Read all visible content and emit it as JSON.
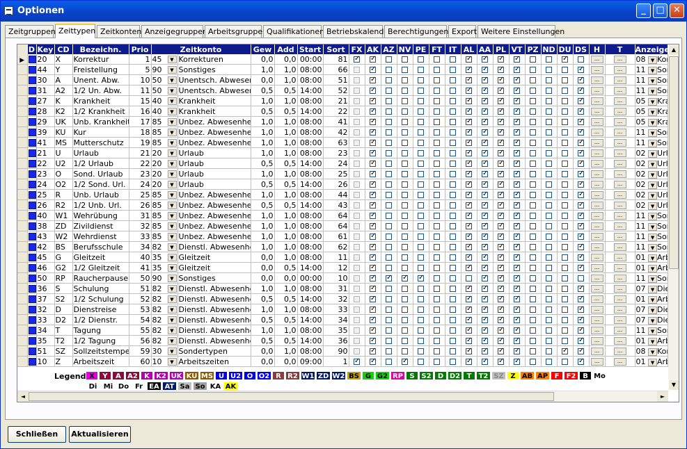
{
  "window": {
    "title": "Optionen"
  },
  "tabs": [
    "Zeitgruppen",
    "Zeittypen",
    "Zeitkonten",
    "Anzeigegruppen",
    "Arbeitsgruppen",
    "Qualifikationen",
    "Betriebskalender",
    "Berechtigungen",
    "Export",
    "Weitere Einstellungen"
  ],
  "active_tab": "Zeittypen",
  "columns": [
    "D",
    "Key",
    "CD",
    "Bezeichn.",
    "Prio",
    "Zeitkonto",
    "Gew",
    "Add",
    "Start",
    "Sort",
    "FX",
    "AK",
    "AZ",
    "NV",
    "PE",
    "FT",
    "IT",
    "AL",
    "AA",
    "PL",
    "VT",
    "PZ",
    "ND",
    "DU",
    "DS",
    "H",
    "T",
    "Anzeige"
  ],
  "rows": [
    {
      "key": "20",
      "cd": "X",
      "name": "Korrektur",
      "prio": "1",
      "zk": "45",
      "konto": "Korrekturen",
      "gew": "0,0",
      "add": "0,0",
      "start": "00:00",
      "sort": "81",
      "flags": "x1000001110110",
      "az_lbl": "08",
      "anz": "Korre"
    },
    {
      "key": "44",
      "cd": "Y",
      "name": "Freistellung",
      "prio": "5",
      "zk": "90",
      "konto": "Sonstiges",
      "gew": "1,0",
      "add": "1,0",
      "start": "08:00",
      "sort": "66",
      "flags": "01000001110001",
      "az_lbl": "11",
      "anz": "Sonst"
    },
    {
      "key": "30",
      "cd": "A",
      "name": "Unent. Abw.",
      "prio": "10",
      "zk": "50",
      "konto": "Unentsch. Abwesenheit",
      "gew": "0,0",
      "add": "1,0",
      "start": "08:00",
      "sort": "51",
      "flags": "01000001110001",
      "az_lbl": "11",
      "anz": "Sonst"
    },
    {
      "key": "31",
      "cd": "A2",
      "name": "1/2 Un. Abw.",
      "prio": "11",
      "zk": "50",
      "konto": "Unentsch. Abwesenheit",
      "gew": "0,5",
      "add": "0,5",
      "start": "14:00",
      "sort": "52",
      "flags": "01000001110001",
      "az_lbl": "11",
      "anz": "Sonst"
    },
    {
      "key": "27",
      "cd": "K",
      "name": "Krankheit",
      "prio": "15",
      "zk": "40",
      "konto": "Krankheit",
      "gew": "1,0",
      "add": "1,0",
      "start": "08:00",
      "sort": "21",
      "flags": "01000001110001",
      "az_lbl": "05",
      "anz": "Krank"
    },
    {
      "key": "28",
      "cd": "K2",
      "name": "1/2 Krankheit",
      "prio": "16",
      "zk": "40",
      "konto": "Krankheit",
      "gew": "0,5",
      "add": "0,5",
      "start": "14:00",
      "sort": "22",
      "flags": "01000001110001",
      "az_lbl": "05",
      "anz": "Krank"
    },
    {
      "key": "29",
      "cd": "UK",
      "name": "Unb. Krankheit",
      "prio": "17",
      "zk": "85",
      "konto": "Unbez. Abwesenheit",
      "gew": "1,0",
      "add": "1,0",
      "start": "08:00",
      "sort": "41",
      "flags": "01000001110001",
      "az_lbl": "05",
      "anz": "Krank"
    },
    {
      "key": "39",
      "cd": "KU",
      "name": "Kur",
      "prio": "18",
      "zk": "85",
      "konto": "Unbez. Abwesenheit",
      "gew": "1,0",
      "add": "1,0",
      "start": "08:00",
      "sort": "42",
      "flags": "01000001110001",
      "az_lbl": "11",
      "anz": "Sonst"
    },
    {
      "key": "41",
      "cd": "MS",
      "name": "Mutterschutz",
      "prio": "19",
      "zk": "85",
      "konto": "Unbez. Abwesenheit",
      "gew": "1,0",
      "add": "1,0",
      "start": "08:00",
      "sort": "63",
      "flags": "01000001110001",
      "az_lbl": "11",
      "anz": "Sonst"
    },
    {
      "key": "21",
      "cd": "U",
      "name": "Urlaub",
      "prio": "21",
      "zk": "20",
      "konto": "Urlaub",
      "gew": "1,0",
      "add": "1,0",
      "start": "08:00",
      "sort": "23",
      "flags": "01000001110001",
      "az_lbl": "02",
      "anz": "Urlau"
    },
    {
      "key": "22",
      "cd": "U2",
      "name": "1/2 Urlaub",
      "prio": "22",
      "zk": "20",
      "konto": "Urlaub",
      "gew": "0,5",
      "add": "0,5",
      "start": "14:00",
      "sort": "24",
      "flags": "01000001110001",
      "az_lbl": "02",
      "anz": "Urlau"
    },
    {
      "key": "23",
      "cd": "O",
      "name": "Sond. Urlaub",
      "prio": "23",
      "zk": "20",
      "konto": "Urlaub",
      "gew": "1,0",
      "add": "1,0",
      "start": "08:00",
      "sort": "25",
      "flags": "01000001110001",
      "az_lbl": "02",
      "anz": "Urlau"
    },
    {
      "key": "24",
      "cd": "O2",
      "name": "1/2 Sond. Url.",
      "prio": "24",
      "zk": "20",
      "konto": "Urlaub",
      "gew": "0,5",
      "add": "0,5",
      "start": "14:00",
      "sort": "26",
      "flags": "01000001110001",
      "az_lbl": "02",
      "anz": "Urlau"
    },
    {
      "key": "25",
      "cd": "R",
      "name": "Unb. Urlaub",
      "prio": "25",
      "zk": "85",
      "konto": "Unbez. Abwesenheit",
      "gew": "1,0",
      "add": "1,0",
      "start": "08:00",
      "sort": "44",
      "flags": "01000001110001",
      "az_lbl": "02",
      "anz": "Urlau"
    },
    {
      "key": "26",
      "cd": "R2",
      "name": "1/2 Unb. Url.",
      "prio": "26",
      "zk": "85",
      "konto": "Unbez. Abwesenheit",
      "gew": "0,5",
      "add": "0,5",
      "start": "14:00",
      "sort": "43",
      "flags": "01000001110001",
      "az_lbl": "02",
      "anz": "Urlau"
    },
    {
      "key": "40",
      "cd": "W1",
      "name": "Wehrübung",
      "prio": "31",
      "zk": "85",
      "konto": "Unbez. Abwesenheit",
      "gew": "1,0",
      "add": "1,0",
      "start": "08:00",
      "sort": "64",
      "flags": "01000001110001",
      "az_lbl": "11",
      "anz": "Sonst"
    },
    {
      "key": "38",
      "cd": "ZD",
      "name": "Zivildienst",
      "prio": "32",
      "zk": "85",
      "konto": "Unbez. Abwesenheit",
      "gew": "1,0",
      "add": "1,0",
      "start": "08:00",
      "sort": "64",
      "flags": "01000001110001",
      "az_lbl": "11",
      "anz": "Sonst"
    },
    {
      "key": "43",
      "cd": "W2",
      "name": "Wehrdienst",
      "prio": "33",
      "zk": "85",
      "konto": "Unbez. Abwesenheit",
      "gew": "1,0",
      "add": "1,0",
      "start": "08:00",
      "sort": "61",
      "flags": "01000001110001",
      "az_lbl": "11",
      "anz": "Sonst"
    },
    {
      "key": "42",
      "cd": "BS",
      "name": "Berufsschule",
      "prio": "34",
      "zk": "82",
      "konto": "Dienstl. Abwesenheit",
      "gew": "1,0",
      "add": "1,0",
      "start": "08:00",
      "sort": "62",
      "flags": "01000001110001",
      "az_lbl": "11",
      "anz": "Sonst"
    },
    {
      "key": "45",
      "cd": "G",
      "name": "Gleitzeit",
      "prio": "40",
      "zk": "35",
      "konto": "Gleitzeit",
      "gew": "0,0",
      "add": "1,0",
      "start": "08:00",
      "sort": "11",
      "flags": "01000001110001",
      "az_lbl": "01",
      "anz": "Arbei"
    },
    {
      "key": "46",
      "cd": "G2",
      "name": "1/2 Gleitzeit",
      "prio": "41",
      "zk": "35",
      "konto": "Gleitzeit",
      "gew": "0,0",
      "add": "0,5",
      "start": "14:00",
      "sort": "12",
      "flags": "01000001110001",
      "az_lbl": "01",
      "anz": "Arbei"
    },
    {
      "key": "50",
      "cd": "RP",
      "name": "Raucherpause",
      "prio": "50",
      "zk": "90",
      "konto": "Sonstiges",
      "gew": "0,0",
      "add": "0,0",
      "start": "00:00",
      "sort": "10",
      "flags": "01111000110000",
      "az_lbl": "11",
      "anz": "Sonst"
    },
    {
      "key": "36",
      "cd": "S",
      "name": "Schulung",
      "prio": "51",
      "zk": "82",
      "konto": "Dienstl. Abwesenheit",
      "gew": "1,0",
      "add": "1,0",
      "start": "08:00",
      "sort": "31",
      "flags": "01000001110001",
      "az_lbl": "07",
      "anz": "Diens"
    },
    {
      "key": "37",
      "cd": "S2",
      "name": "1/2 Schulung",
      "prio": "52",
      "zk": "82",
      "konto": "Dienstl. Abwesenheit",
      "gew": "0,5",
      "add": "0,5",
      "start": "14:00",
      "sort": "32",
      "flags": "01000001110001",
      "az_lbl": "01",
      "anz": "Arbei"
    },
    {
      "key": "32",
      "cd": "D",
      "name": "Dienstreise",
      "prio": "53",
      "zk": "82",
      "konto": "Dienstl. Abwesenheit",
      "gew": "1,0",
      "add": "1,0",
      "start": "08:00",
      "sort": "33",
      "flags": "01000001110001",
      "az_lbl": "07",
      "anz": "Diens"
    },
    {
      "key": "33",
      "cd": "D2",
      "name": "1/2 Dienstr.",
      "prio": "54",
      "zk": "82",
      "konto": "Dienstl. Abwesenheit",
      "gew": "0,5",
      "add": "0,5",
      "start": "14:00",
      "sort": "34",
      "flags": "01000001110001",
      "az_lbl": "07",
      "anz": "Diens"
    },
    {
      "key": "34",
      "cd": "T",
      "name": "Tagung",
      "prio": "55",
      "zk": "82",
      "konto": "Dienstl. Abwesenheit",
      "gew": "1,0",
      "add": "1,0",
      "start": "08:00",
      "sort": "35",
      "flags": "01000001110001",
      "az_lbl": "11",
      "anz": "Sonst"
    },
    {
      "key": "35",
      "cd": "T2",
      "name": "1/2 Tagung",
      "prio": "56",
      "zk": "82",
      "konto": "Dienstl. Abwesenheit",
      "gew": "0,5",
      "add": "0,5",
      "start": "14:00",
      "sort": "36",
      "flags": "01000001110001",
      "az_lbl": "01",
      "anz": "Arbei"
    },
    {
      "key": "51",
      "cd": "SZ",
      "name": "Sollzeitstempel",
      "prio": "59",
      "zk": "30",
      "konto": "Sondertypen",
      "gew": "0,0",
      "add": "1,0",
      "start": "08:00",
      "sort": "90",
      "flags": "01000001110011",
      "az_lbl": "08",
      "anz": "Korre"
    },
    {
      "key": "10",
      "cd": "Z",
      "name": "Arbeitszeit",
      "prio": "60",
      "zk": "10",
      "konto": "Arbeitszeiten",
      "gew": "0,0",
      "add": "0,0",
      "start": "09:00",
      "sort": "1",
      "flags": "11010001110001",
      "az_lbl": "01",
      "anz": "Arbei"
    }
  ],
  "legend": {
    "label": "Legende",
    "row1": [
      {
        "t": "X",
        "bg": "#e000e0",
        "fg": "#000"
      },
      {
        "t": "Y",
        "bg": "#8a0a3a",
        "fg": "#fff"
      },
      {
        "t": "A",
        "bg": "#8a0a3a",
        "fg": "#fff"
      },
      {
        "t": "A2",
        "bg": "#8a0a3a",
        "fg": "#fff"
      },
      {
        "t": "K",
        "bg": "#b000b0",
        "fg": "#fff"
      },
      {
        "t": "K2",
        "bg": "#b000b0",
        "fg": "#fff"
      },
      {
        "t": "UK",
        "bg": "#b000b0",
        "fg": "#fff"
      },
      {
        "t": "KU",
        "bg": "#8a5a00",
        "fg": "#fff"
      },
      {
        "t": "MS",
        "bg": "#8a5a00",
        "fg": "#fff"
      },
      {
        "t": "U",
        "bg": "#0000ee",
        "fg": "#fff"
      },
      {
        "t": "U2",
        "bg": "#0000ee",
        "fg": "#fff"
      },
      {
        "t": "O",
        "bg": "#0000ee",
        "fg": "#fff"
      },
      {
        "t": "O2",
        "bg": "#0000ee",
        "fg": "#fff"
      },
      {
        "t": "R",
        "bg": "#8a3a3a",
        "fg": "#fff"
      },
      {
        "t": "R2",
        "bg": "#8a3a3a",
        "fg": "#fff"
      },
      {
        "t": "W1",
        "bg": "#001a6a",
        "fg": "#fff"
      },
      {
        "t": "ZD",
        "bg": "#001a6a",
        "fg": "#fff"
      },
      {
        "t": "W2",
        "bg": "#001a6a",
        "fg": "#fff"
      },
      {
        "t": "BS",
        "bg": "#c0a000",
        "fg": "#000"
      },
      {
        "t": "G",
        "bg": "#10d010",
        "fg": "#000"
      },
      {
        "t": "G2",
        "bg": "#10d010",
        "fg": "#000"
      },
      {
        "t": "RP",
        "bg": "#e000a0",
        "fg": "#fff"
      },
      {
        "t": "S",
        "bg": "#007a00",
        "fg": "#fff"
      },
      {
        "t": "S2",
        "bg": "#007a00",
        "fg": "#fff"
      },
      {
        "t": "D",
        "bg": "#007a00",
        "fg": "#fff"
      },
      {
        "t": "D2",
        "bg": "#007a00",
        "fg": "#fff"
      },
      {
        "t": "T",
        "bg": "#007a00",
        "fg": "#fff"
      },
      {
        "t": "T2",
        "bg": "#007a00",
        "fg": "#fff"
      },
      {
        "t": "SZ",
        "bg": "#c0c0c0",
        "fg": "#888"
      },
      {
        "t": "Z",
        "bg": "#ffff00",
        "fg": "#000"
      },
      {
        "t": "AB",
        "bg": "#ff8000",
        "fg": "#000"
      },
      {
        "t": "AP",
        "bg": "#ff8000",
        "fg": "#000"
      },
      {
        "t": "F",
        "bg": "#ff0000",
        "fg": "#fff"
      },
      {
        "t": "F2",
        "bg": "#ff0000",
        "fg": "#fff"
      },
      {
        "t": "B",
        "bg": "#000000",
        "fg": "#fff"
      },
      {
        "t": "Mo",
        "bg": "#ffffff",
        "fg": "#000"
      }
    ],
    "row2": [
      {
        "t": "Di",
        "bg": "#ffffff",
        "fg": "#000"
      },
      {
        "t": "Mi",
        "bg": "#ffffff",
        "fg": "#000"
      },
      {
        "t": "Do",
        "bg": "#ffffff",
        "fg": "#000"
      },
      {
        "t": "Fr",
        "bg": "#ffffff",
        "fg": "#000"
      },
      {
        "t": "EA",
        "bg": "#000000",
        "fg": "#fff"
      },
      {
        "t": "AT",
        "bg": "#001a6a",
        "fg": "#fff"
      },
      {
        "t": "Sa",
        "bg": "#c0c0c0",
        "fg": "#000"
      },
      {
        "t": "So",
        "bg": "#a0a0a0",
        "fg": "#000"
      },
      {
        "t": "KA",
        "bg": "#ffffff",
        "fg": "#000"
      },
      {
        "t": "AK",
        "bg": "#ffff00",
        "fg": "#000"
      }
    ]
  },
  "buttons": {
    "close": "Schließen",
    "refresh": "Aktualisieren"
  },
  "icons": {
    "row_pointer": "row-pointer-icon",
    "dropdown": "dropdown-arrow-icon",
    "ellipsis": "ellipsis-icon"
  },
  "colors": {
    "header_bg": "#0d1b8c",
    "d_square": "#1a28e6",
    "title_bar": "#0842c8"
  }
}
